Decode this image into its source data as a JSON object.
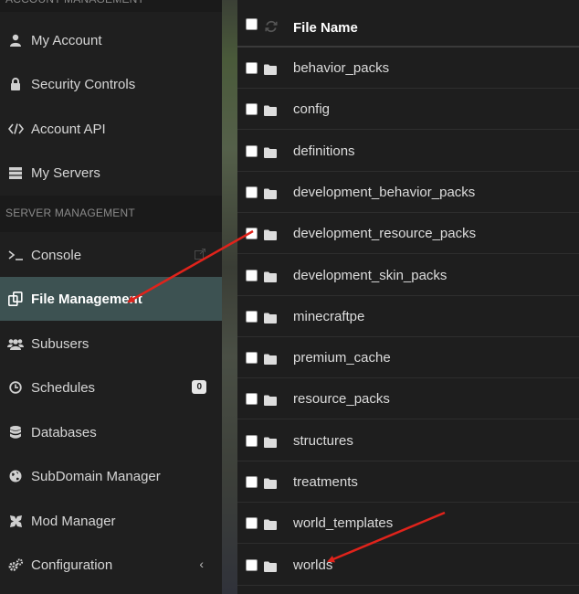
{
  "sidebar": {
    "account_header": "ACCOUNT MANAGEMENT",
    "account_items": [
      {
        "label": "My Account",
        "icon": "user-icon"
      },
      {
        "label": "Security Controls",
        "icon": "lock-icon"
      },
      {
        "label": "Account API",
        "icon": "code-icon"
      },
      {
        "label": "My Servers",
        "icon": "server-icon"
      }
    ],
    "server_header": "SERVER MANAGEMENT",
    "server_items": [
      {
        "label": "Console",
        "icon": "terminal-icon"
      },
      {
        "label": "File Management",
        "icon": "files-icon"
      },
      {
        "label": "Subusers",
        "icon": "users-icon"
      },
      {
        "label": "Schedules",
        "icon": "clock-icon",
        "badge": "0"
      },
      {
        "label": "Databases",
        "icon": "database-icon"
      },
      {
        "label": "SubDomain Manager",
        "icon": "globe-icon"
      },
      {
        "label": "Mod Manager",
        "icon": "puzzle-icon"
      },
      {
        "label": "Configuration",
        "icon": "gears-icon"
      }
    ],
    "active_color": "#3d5252"
  },
  "files": {
    "column_header": "File Name",
    "rows": [
      "behavior_packs",
      "config",
      "definitions",
      "development_behavior_packs",
      "development_resource_packs",
      "development_skin_packs",
      "minecraftpe",
      "premium_cache",
      "resource_packs",
      "structures",
      "treatments",
      "world_templates",
      "worlds"
    ]
  },
  "annotations": {
    "arrow_color": "#e0231b"
  }
}
